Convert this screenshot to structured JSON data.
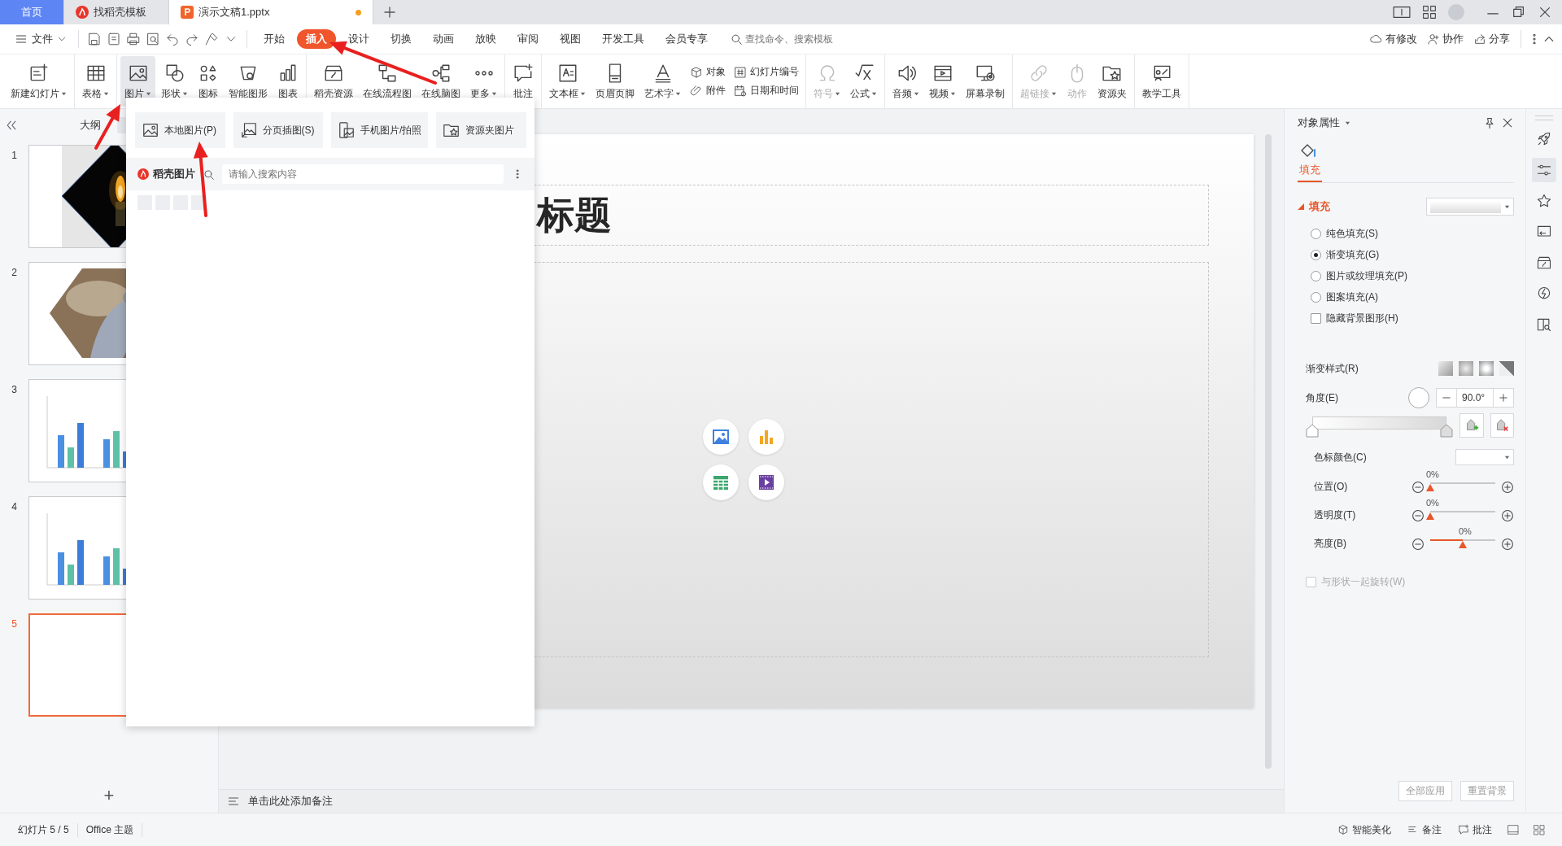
{
  "title_tabs": [
    {
      "label": "首页",
      "kind": "home",
      "selected": false
    },
    {
      "label": "找稻壳模板",
      "kind": "template",
      "selected": false
    },
    {
      "label": "演示文稿1.pptx",
      "kind": "document",
      "selected": true,
      "unsaved": true
    }
  ],
  "menu": {
    "file": "文件",
    "tabs": [
      {
        "label": "开始",
        "selected": false
      },
      {
        "label": "插入",
        "selected": true
      },
      {
        "label": "设计",
        "selected": false
      },
      {
        "label": "切换",
        "selected": false
      },
      {
        "label": "动画",
        "selected": false
      },
      {
        "label": "放映",
        "selected": false
      },
      {
        "label": "审阅",
        "selected": false
      },
      {
        "label": "视图",
        "selected": false
      },
      {
        "label": "开发工具",
        "selected": false
      },
      {
        "label": "会员专享",
        "selected": false
      }
    ],
    "search": {
      "placeholder": "查找命令、搜索模板"
    },
    "actions": [
      "有修改",
      "协作",
      "分享"
    ]
  },
  "ribbon": {
    "groups": [
      [
        {
          "kind": "large",
          "label": "新建幻灯片",
          "caret": true,
          "disabled": false,
          "pressed": false
        }
      ],
      [
        {
          "kind": "large",
          "label": "表格",
          "caret": true,
          "disabled": false,
          "pressed": false
        }
      ],
      [
        {
          "kind": "large",
          "label": "图片",
          "caret": true,
          "disabled": false,
          "pressed": true
        },
        {
          "kind": "large",
          "label": "形状",
          "caret": true,
          "disabled": false,
          "pressed": false
        },
        {
          "kind": "large",
          "label": "图标",
          "caret": false,
          "disabled": false,
          "pressed": false
        },
        {
          "kind": "large",
          "label": "智能图形",
          "caret": false,
          "disabled": false,
          "pressed": false
        },
        {
          "kind": "large",
          "label": "图表",
          "caret": false,
          "disabled": false,
          "pressed": false
        }
      ],
      [
        {
          "kind": "large",
          "label": "稻壳资源",
          "caret": false,
          "disabled": false,
          "pressed": false
        },
        {
          "kind": "large",
          "label": "在线流程图",
          "caret": false,
          "disabled": false,
          "pressed": false
        },
        {
          "kind": "large",
          "label": "在线脑图",
          "caret": false,
          "disabled": false,
          "pressed": false
        },
        {
          "kind": "large",
          "label": "更多",
          "caret": true,
          "disabled": false,
          "pressed": false
        }
      ],
      [
        {
          "kind": "large",
          "label": "批注",
          "caret": false,
          "disabled": false,
          "pressed": false
        }
      ],
      [
        {
          "kind": "large",
          "label": "文本框",
          "caret": true,
          "disabled": false,
          "pressed": false
        },
        {
          "kind": "large",
          "label": "页眉页脚",
          "caret": false,
          "disabled": false,
          "pressed": false
        },
        {
          "kind": "large",
          "label": "艺术字",
          "caret": true,
          "disabled": false,
          "pressed": false
        },
        {
          "kind": "pair",
          "items": [
            {
              "label": "对象"
            },
            {
              "label": "附件"
            }
          ]
        },
        {
          "kind": "pair",
          "items": [
            {
              "label": "幻灯片编号"
            },
            {
              "label": "日期和时间"
            }
          ]
        }
      ],
      [
        {
          "kind": "large",
          "label": "符号",
          "caret": true,
          "disabled": true,
          "pressed": false
        },
        {
          "kind": "large",
          "label": "公式",
          "caret": true,
          "disabled": false,
          "pressed": false
        }
      ],
      [
        {
          "kind": "large",
          "label": "音频",
          "caret": true,
          "disabled": false,
          "pressed": false
        },
        {
          "kind": "large",
          "label": "视频",
          "caret": true,
          "disabled": false,
          "pressed": false
        },
        {
          "kind": "large",
          "label": "屏幕录制",
          "caret": false,
          "disabled": false,
          "pressed": false
        }
      ],
      [
        {
          "kind": "large",
          "label": "超链接",
          "caret": true,
          "disabled": true,
          "pressed": false
        },
        {
          "kind": "large",
          "label": "动作",
          "caret": false,
          "disabled": true,
          "pressed": false
        },
        {
          "kind": "large",
          "label": "资源夹",
          "caret": false,
          "disabled": false,
          "pressed": false
        }
      ],
      [
        {
          "kind": "large",
          "label": "教学工具",
          "caret": false,
          "disabled": false,
          "pressed": false
        }
      ]
    ]
  },
  "slides_panel": {
    "tabs": [
      {
        "label": "大纲",
        "selected": false
      },
      {
        "selected": true
      }
    ],
    "slides": [
      {
        "number": "1",
        "kind": "candle",
        "selected": false
      },
      {
        "number": "2",
        "kind": "bird",
        "selected": false
      },
      {
        "number": "3",
        "kind": "bars",
        "selected": false
      },
      {
        "number": "4",
        "kind": "bars",
        "selected": false
      },
      {
        "number": "5",
        "kind": "blank",
        "selected": true
      }
    ],
    "add_button": "+"
  },
  "slide": {
    "title": "标题"
  },
  "picture_menu": {
    "buttons": [
      "本地图片(P)",
      "分页插图(S)",
      "手机图片/拍照",
      "资源夹图片"
    ],
    "source": "稻壳图片",
    "search": {
      "placeholder": "请输入搜索内容"
    }
  },
  "notes": {
    "placeholder": "单击此处添加备注"
  },
  "properties": {
    "title": "对象属性",
    "tabs": [
      {
        "label": "填充",
        "selected": true
      }
    ],
    "section": "填充",
    "options": [
      {
        "kind": "radio",
        "label": "纯色填充(S)",
        "checked": false
      },
      {
        "kind": "radio",
        "label": "渐变填充(G)",
        "checked": true
      },
      {
        "kind": "radio",
        "label": "图片或纹理填充(P)",
        "checked": false
      },
      {
        "kind": "radio",
        "label": "图案填充(A)",
        "checked": false
      },
      {
        "kind": "checkbox",
        "label": "隐藏背景图形(H)",
        "checked": false
      }
    ],
    "gradient_style_label": "渐变样式(R)",
    "angle": {
      "label": "角度(E)",
      "value": "90.0°"
    },
    "stop_color_label": "色标颜色(C)",
    "sliders": [
      {
        "label": "位置(O)",
        "reading": "0%",
        "level": 0
      },
      {
        "label": "透明度(T)",
        "reading": "0%",
        "level": 0
      },
      {
        "label": "亮度(B)",
        "reading": "0%",
        "level": 0.5
      }
    ],
    "rotate": {
      "label": "与形状一起旋转(W)",
      "checked": false,
      "disabled": true
    },
    "buttons": [
      "全部应用",
      "重置背景"
    ]
  },
  "status": {
    "left": [
      "幻灯片 5 / 5",
      "Office 主题"
    ],
    "right": [
      "智能美化",
      "备注",
      "批注"
    ]
  }
}
